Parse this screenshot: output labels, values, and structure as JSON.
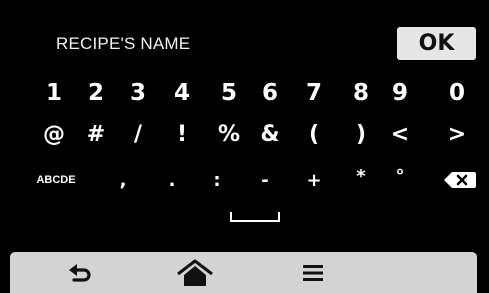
{
  "header": {
    "title": "RECIPE'S NAME",
    "ok_label": "OK"
  },
  "keyboard": {
    "row1": [
      "1",
      "2",
      "3",
      "4",
      "5",
      "6",
      "7",
      "8",
      "9",
      "0"
    ],
    "row2": [
      "@",
      "#",
      "/",
      "!",
      "%",
      "&",
      "(",
      ")",
      "<",
      ">"
    ],
    "row3": [
      "ABCDE",
      ",",
      ".",
      ":",
      "-",
      "+",
      "*",
      "°"
    ],
    "backspace_icon": "backspace-icon",
    "space_icon": "space-bar-icon"
  },
  "nav": {
    "back_icon": "back-arrow-icon",
    "home_icon": "home-icon",
    "menu_icon": "menu-icon"
  },
  "colors": {
    "background": "#000000",
    "key_text": "#ffffff",
    "ok_background": "#e6e6e6",
    "nav_bar": "#d3d3d3"
  }
}
